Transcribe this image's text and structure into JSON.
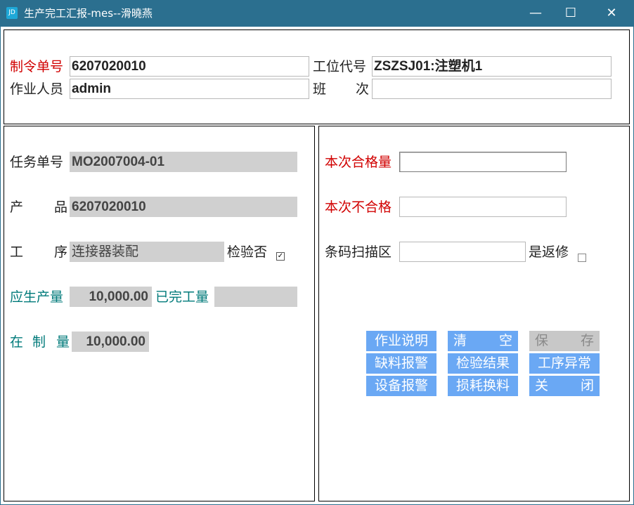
{
  "window": {
    "title": "生产完工汇报-mes--滑曉燕",
    "icon_label": "JD",
    "minimize_glyph": "—",
    "maximize_glyph": "☐",
    "close_glyph": "✕"
  },
  "header": {
    "order_no_label": "制令单号",
    "order_no_value": "6207020010",
    "station_label": "工位代号",
    "station_value": "ZSZSJ01:注塑机1",
    "operator_label": "作业人员",
    "operator_value": "admin",
    "shift_label_1": "班",
    "shift_label_2": "次",
    "shift_value": ""
  },
  "left": {
    "task_no_label": "任务单号",
    "task_no_value": "MO2007004-01",
    "product_label_1": "产",
    "product_label_2": "品",
    "product_value": "6207020010",
    "process_label_1": "工",
    "process_label_2": "序",
    "process_value": "连接器装配",
    "inspect_label": "检验否",
    "inspect_checked": true,
    "inspect_mark": "✓",
    "planned_qty_label": "应生产量",
    "planned_qty_value": "10,000.00",
    "done_qty_label": "已完工量",
    "done_qty_value": "",
    "wip_label_1": "在",
    "wip_label_2": "制",
    "wip_label_3": "量",
    "wip_value": "10,000.00"
  },
  "right": {
    "qualified_label": "本次合格量",
    "qualified_value": "",
    "unqualified_label": "本次不合格",
    "unqualified_value": "",
    "barcode_label": "条码扫描区",
    "barcode_value": "",
    "rework_label": "是返修",
    "rework_checked": false
  },
  "buttons": {
    "work_instructions": "作业说明",
    "clear_1": "清",
    "clear_2": "空",
    "save_1": "保",
    "save_2": "存",
    "material_alarm": "缺料报警",
    "inspection_result": "检验结果",
    "process_exception": "工序异常",
    "equipment_alarm": "设备报警",
    "loss_replace": "损耗换料",
    "close_1": "关",
    "close_2": "闭"
  },
  "colors": {
    "titlebar": "#2b6f8f",
    "required_label": "#d10000",
    "qty_label": "#007a7a",
    "button": "#6aa8f4",
    "button_disabled": "#c8c8c8",
    "readonly_field": "#d0d0d0"
  }
}
